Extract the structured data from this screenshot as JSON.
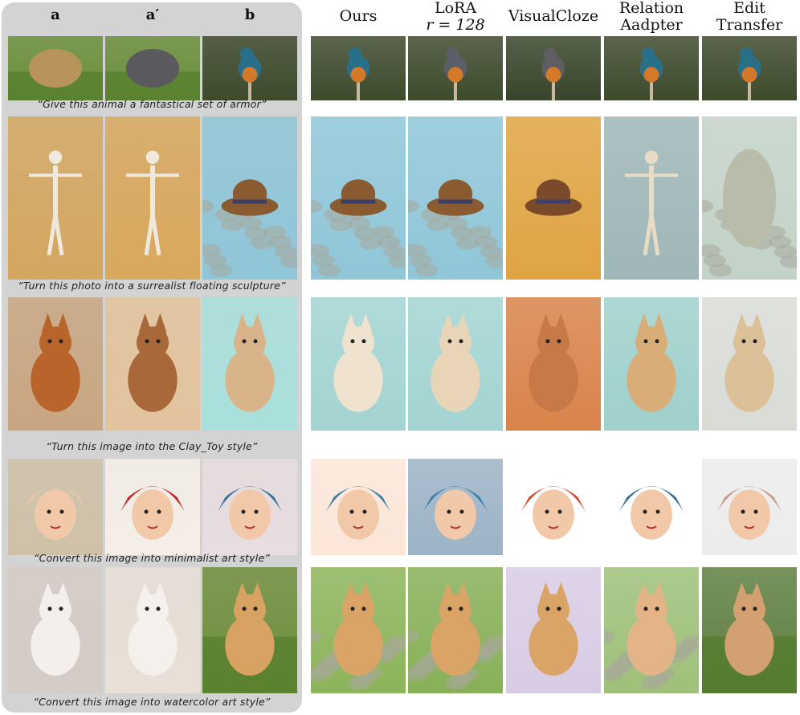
{
  "headers": {
    "source": [
      "a",
      "a′",
      "b"
    ],
    "methods": [
      [
        "Ours"
      ],
      [
        "LoRA",
        "r = 128"
      ],
      [
        "VisualCloze"
      ],
      [
        "Relation",
        "Aadpter"
      ],
      [
        "Edit",
        "Transfer"
      ]
    ]
  },
  "rows": [
    {
      "caption": "“Give this animal a fantastical set of armor”",
      "cells": [
        {
          "subject": "cow",
          "bg": "#6b8f3a",
          "fg": "#b8945a"
        },
        {
          "subject": "armored-cow",
          "bg": "#6b8f3a",
          "fg": "#5a5a5e"
        },
        {
          "subject": "kingfisher",
          "bg": "#3d4a2c",
          "fg": "#2a6f8a"
        },
        {
          "subject": "kingfisher",
          "bg": "#3d4a2c",
          "fg": "#2a6f8a"
        },
        {
          "subject": "armored-kingfisher",
          "bg": "#3d4a2c",
          "fg": "#5b5e66"
        },
        {
          "subject": "armored-bird",
          "bg": "#38452a",
          "fg": "#5e5e62"
        },
        {
          "subject": "kingfisher",
          "bg": "#3d4a2c",
          "fg": "#2a6f8a"
        },
        {
          "subject": "kingfisher",
          "bg": "#3d4a2c",
          "fg": "#2a6f8a"
        }
      ]
    },
    {
      "caption": "“Turn this photo into a surrealist floating sculpture”",
      "cells": [
        {
          "subject": "mannequin",
          "bg": "#d4a760",
          "fg": "#efe8dc"
        },
        {
          "subject": "mannequin",
          "bg": "#d8a85c",
          "fg": "#efe8dc"
        },
        {
          "subject": "hat-on-water",
          "bg": "#8fc6d8",
          "fg": "#8a5a30"
        },
        {
          "subject": "hat-on-water",
          "bg": "#8fc6d8",
          "fg": "#8a5a30"
        },
        {
          "subject": "hat-on-water",
          "bg": "#8fc6d8",
          "fg": "#8a5a30"
        },
        {
          "subject": "hat-stack",
          "bg": "#e0a442",
          "fg": "#7a4a2a"
        },
        {
          "subject": "marshmallow-figure",
          "bg": "#9fb6b8",
          "fg": "#e8dcc4"
        },
        {
          "subject": "water",
          "bg": "#c3d2c8",
          "fg": "#b8bca8"
        }
      ]
    },
    {
      "caption": "“Turn this image into the Clay_Toy style”",
      "cells": [
        {
          "subject": "stretching-cat",
          "bg": "#c9a682",
          "fg": "#b8642a"
        },
        {
          "subject": "clay-cat",
          "bg": "#e3c39c",
          "fg": "#a8683a"
        },
        {
          "subject": "sitting-cat",
          "bg": "#a9e0dc",
          "fg": "#d9b48a"
        },
        {
          "subject": "sitting-cat",
          "bg": "#a2d4d2",
          "fg": "#efe3cf"
        },
        {
          "subject": "sitting-cat",
          "bg": "#a2d4d2",
          "fg": "#e8d5b8"
        },
        {
          "subject": "clay-figure",
          "bg": "#d9834a",
          "fg": "#c77a48"
        },
        {
          "subject": "sitting-cat",
          "bg": "#9fd0cc",
          "fg": "#d8ad78"
        },
        {
          "subject": "sitting-cat",
          "bg": "#d9dcd6",
          "fg": "#dcc198"
        }
      ]
    },
    {
      "caption": "“Convert this image into minimalist art style”",
      "cells": [
        {
          "subject": "portrait-painting",
          "bg": "#cfc1a8",
          "fg": "#e5c7a8"
        },
        {
          "subject": "headscarf-woman",
          "bg": "#f5efe8",
          "fg": "#c8282a"
        },
        {
          "subject": "opera-face",
          "bg": "#e8dde0",
          "fg": "#3a6f9a"
        },
        {
          "subject": "opera-face-art",
          "bg": "#fbe6d8",
          "fg": "#3a7fa8"
        },
        {
          "subject": "opera-face-art",
          "bg": "#9cb3c6",
          "fg": "#3a7fa8"
        },
        {
          "subject": "woman-scarf-art",
          "bg": "#ffffff",
          "fg": "#d44a3a"
        },
        {
          "subject": "opera-face-art",
          "bg": "#ffffff",
          "fg": "#3a6f9a"
        },
        {
          "subject": "woman-portrait",
          "bg": "#ececec",
          "fg": "#c89a88"
        }
      ]
    },
    {
      "caption": "“Convert this image into watercolor art style”",
      "cells": [
        {
          "subject": "white-cat",
          "bg": "#d4ccc6",
          "fg": "#f2efec"
        },
        {
          "subject": "white-cat-art",
          "bg": "#e8e0d6",
          "fg": "#f4f1ec"
        },
        {
          "subject": "dog-on-grass",
          "bg": "#6f8f3c",
          "fg": "#d7a262"
        },
        {
          "subject": "dog-watercolor",
          "bg": "#8db45a",
          "fg": "#dba467"
        },
        {
          "subject": "dog-watercolor",
          "bg": "#88b058",
          "fg": "#dba467"
        },
        {
          "subject": "dog-flowers",
          "bg": "#d8cce4",
          "fg": "#dba467"
        },
        {
          "subject": "dog-watercolor",
          "bg": "#9fc07a",
          "fg": "#e2b487"
        },
        {
          "subject": "dog-on-grass",
          "bg": "#5f7f40",
          "fg": "#d3a071"
        }
      ]
    }
  ]
}
